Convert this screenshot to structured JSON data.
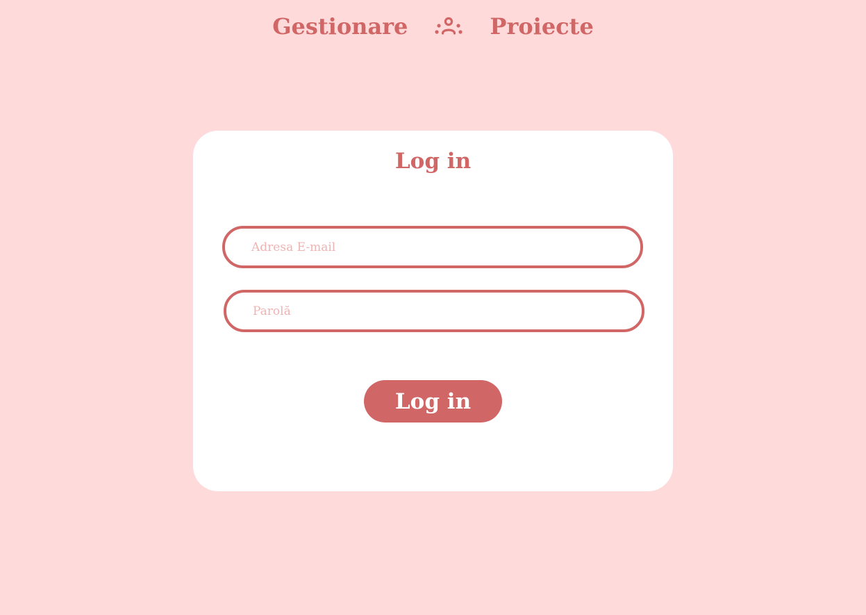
{
  "header": {
    "brand_left": "Gestionare",
    "brand_right": "Proiecte",
    "icon": "team-users-icon"
  },
  "login": {
    "title": "Log in",
    "email_placeholder": "Adresa E-mail",
    "email_value": "",
    "password_placeholder": "Parolă",
    "password_value": "",
    "submit_label": "Log in"
  },
  "colors": {
    "background": "#FFDADA",
    "accent": "#D06666",
    "card": "#FFFFFF",
    "placeholder": "#EFB3B3"
  }
}
